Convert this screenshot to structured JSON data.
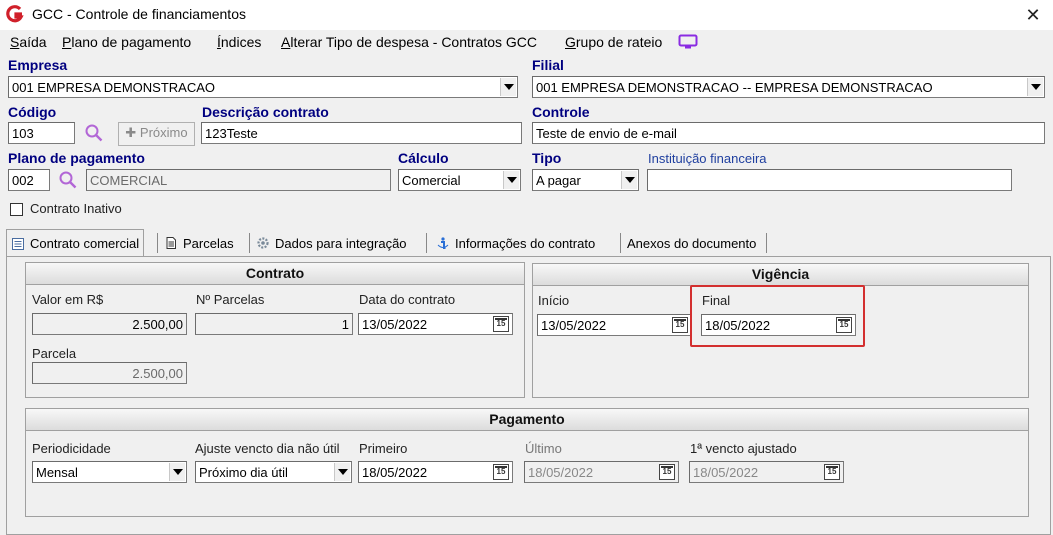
{
  "window": {
    "title": "GCC - Controle de financiamentos",
    "close_glyph": "✕"
  },
  "menu": {
    "items": [
      {
        "u": "S",
        "rest": "aída"
      },
      {
        "u": "P",
        "rest": "lano de pagamento"
      },
      {
        "u": "Í",
        "rest": "ndices"
      },
      {
        "u": "A",
        "rest": "lterar Tipo de despesa - Contratos GCC"
      },
      {
        "u": "G",
        "rest": "rupo de rateio"
      }
    ]
  },
  "header": {
    "empresa_label": "Empresa",
    "empresa_value": "001 EMPRESA DEMONSTRACAO",
    "filial_label": "Filial",
    "filial_value": "001 EMPRESA DEMONSTRACAO -- EMPRESA DEMONSTRACAO",
    "codigo_label": "Código",
    "codigo_value": "103",
    "proximo_label": "Próximo",
    "descricao_label": "Descrição contrato",
    "descricao_value": "123Teste",
    "controle_label": "Controle",
    "controle_value": "Teste de envio  de e-mail",
    "plano_label": "Plano de pagamento",
    "plano_code": "002",
    "plano_name": "COMERCIAL",
    "calculo_label": "Cálculo",
    "calculo_value": "Comercial",
    "tipo_label": "Tipo",
    "tipo_value": "A pagar",
    "instituicao_label": "Instituição financeira",
    "instituicao_value": "",
    "inativo_label": "Contrato Inativo",
    "inativo_checked": false
  },
  "tabs": [
    {
      "label": "Contrato comercial",
      "icon": "contract-icon",
      "active": true
    },
    {
      "label": "Parcelas",
      "icon": "document-icon",
      "active": false
    },
    {
      "label": "Dados para integração",
      "icon": "gear-icon",
      "active": false
    },
    {
      "label": "Informações do contrato",
      "icon": "info-icon",
      "active": false
    },
    {
      "label": "Anexos do documento",
      "icon": "",
      "active": false
    }
  ],
  "contrato": {
    "title": "Contrato",
    "valor_label": "Valor em R$",
    "valor_value": "2.500,00",
    "parcelas_label": "Nº Parcelas",
    "parcelas_value": "1",
    "data_label": "Data do contrato",
    "data_value": "13/05/2022",
    "parcela_label": "Parcela",
    "parcela_value": "2.500,00"
  },
  "vigencia": {
    "title": "Vigência",
    "inicio_label": "Início",
    "inicio_value": "13/05/2022",
    "final_label": "Final",
    "final_value": "18/05/2022"
  },
  "pagamento": {
    "title": "Pagamento",
    "periodicidade_label": "Periodicidade",
    "periodicidade_value": "Mensal",
    "ajuste_label": "Ajuste vencto dia não útil",
    "ajuste_value": "Próximo dia útil",
    "primeiro_label": "Primeiro",
    "primeiro_value": "18/05/2022",
    "ultimo_label": "Último",
    "ultimo_value": "18/05/2022",
    "vencto_label": "1ª vencto ajustado",
    "vencto_value": "18/05/2022"
  },
  "colors": {
    "accent_label": "#000080",
    "highlight": "#d32f2f",
    "logo": "#d0202a",
    "screen_icon": "#8a2be2"
  },
  "calendar_glyph": "15"
}
